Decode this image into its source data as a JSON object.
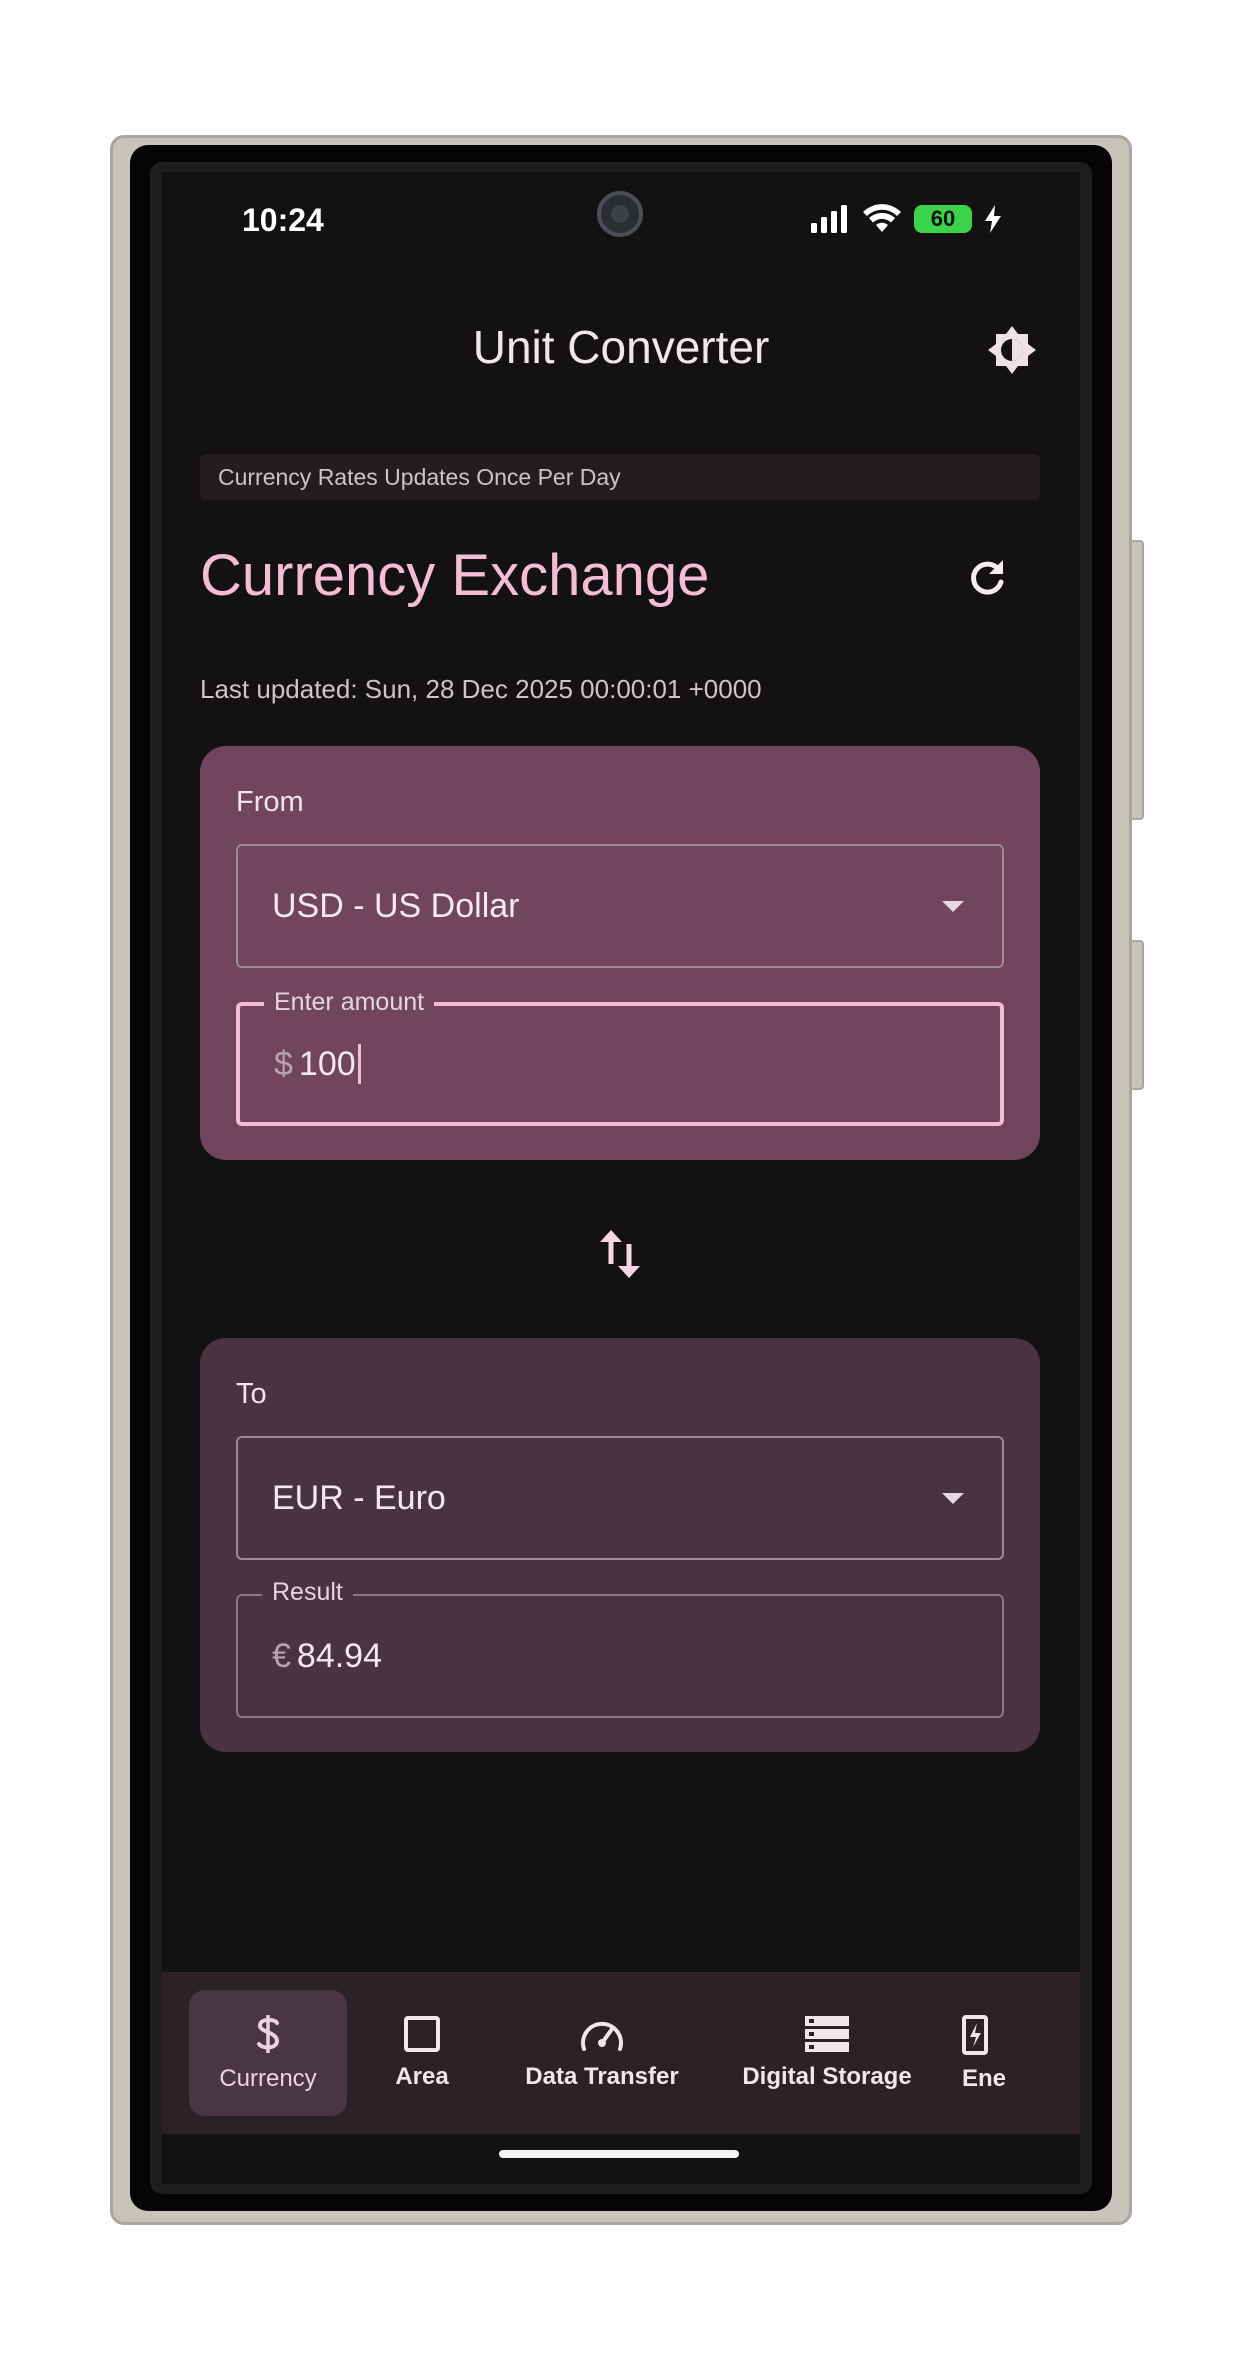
{
  "status_bar": {
    "time": "10:24",
    "battery_level": "60",
    "icons": [
      "signal-icon",
      "wifi-icon",
      "battery-icon",
      "charging-icon"
    ]
  },
  "app": {
    "title": "Unit Converter",
    "notice": "Currency Rates Updates Once Per Day"
  },
  "exchange": {
    "title": "Currency Exchange",
    "last_updated": "Last updated: Sun, 28 Dec 2025 00:00:01 +0000",
    "from": {
      "label": "From",
      "currency": "USD - US Dollar",
      "amount_label": "Enter amount",
      "prefix": "$",
      "amount": "100"
    },
    "to": {
      "label": "To",
      "currency": "EUR - Euro",
      "result_label": "Result",
      "prefix": "€",
      "result": "84.94"
    }
  },
  "nav": {
    "items": [
      {
        "label": "Currency",
        "icon": "dollar-icon",
        "active": true
      },
      {
        "label": "Area",
        "icon": "square-icon"
      },
      {
        "label": "Data Transfer",
        "icon": "speedometer-icon"
      },
      {
        "label": "Digital Storage",
        "icon": "storage-icon"
      },
      {
        "label": "Ene",
        "icon": "energy-icon"
      }
    ]
  },
  "colors": {
    "accent": "#f5bcd6",
    "from_card": "#71465d",
    "to_card": "#4a3340",
    "background": "#141113"
  }
}
